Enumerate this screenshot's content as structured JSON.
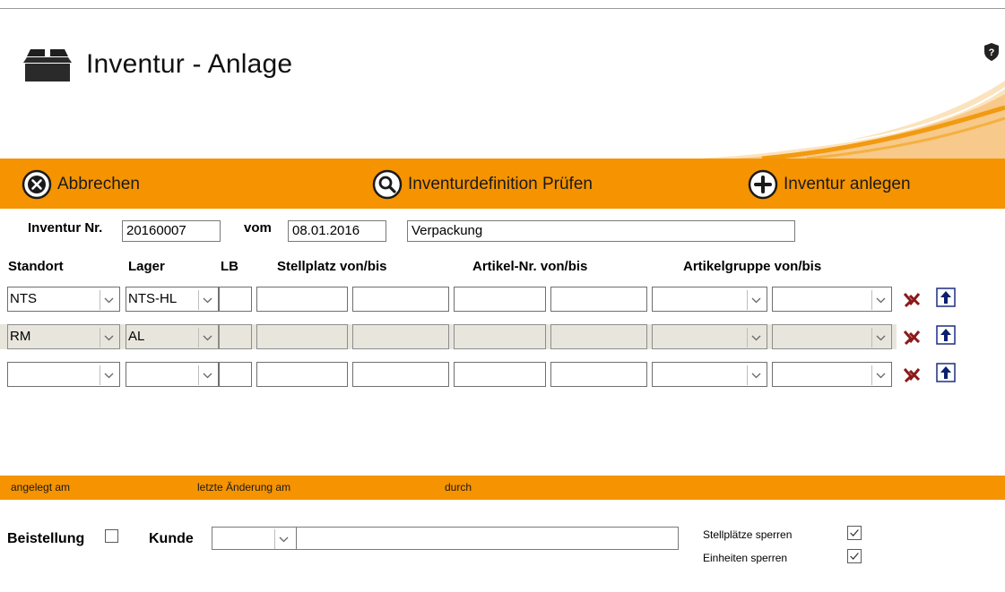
{
  "header": {
    "title": "Inventur - Anlage",
    "icon": "box-icon",
    "help_icon": "shield-help-icon"
  },
  "toolbar": {
    "cancel_label": "Abbrechen",
    "check_label": "Inventurdefinition Prüfen",
    "create_label": "Inventur anlegen"
  },
  "form": {
    "inventur_nr_label": "Inventur Nr.",
    "inventur_nr_value": "20160007",
    "vom_label": "vom",
    "vom_value": "08.01.2016",
    "description_value": "Verpackung"
  },
  "grid": {
    "headers": {
      "standort": "Standort",
      "lager": "Lager",
      "lb": "LB",
      "stellplatz": "Stellplatz von/bis",
      "artikel": "Artikel-Nr. von/bis",
      "artikelgruppe": "Artikelgruppe von/bis"
    },
    "rows": [
      {
        "standort": "NTS",
        "lager": "NTS-HL"
      },
      {
        "standort": "RM",
        "lager": "AL"
      },
      {
        "standort": "",
        "lager": ""
      }
    ]
  },
  "status": {
    "created_label": "angelegt am",
    "changed_label": "letzte Änderung am",
    "by_label": "durch"
  },
  "bottom": {
    "beistellung_label": "Beistellung",
    "kunde_label": "Kunde",
    "stellplaetze_label": "Stellplätze sperren",
    "einheiten_label": "Einheiten sperren"
  },
  "colors": {
    "accent": "#f59300",
    "row_shade": "#e8e6dc"
  }
}
